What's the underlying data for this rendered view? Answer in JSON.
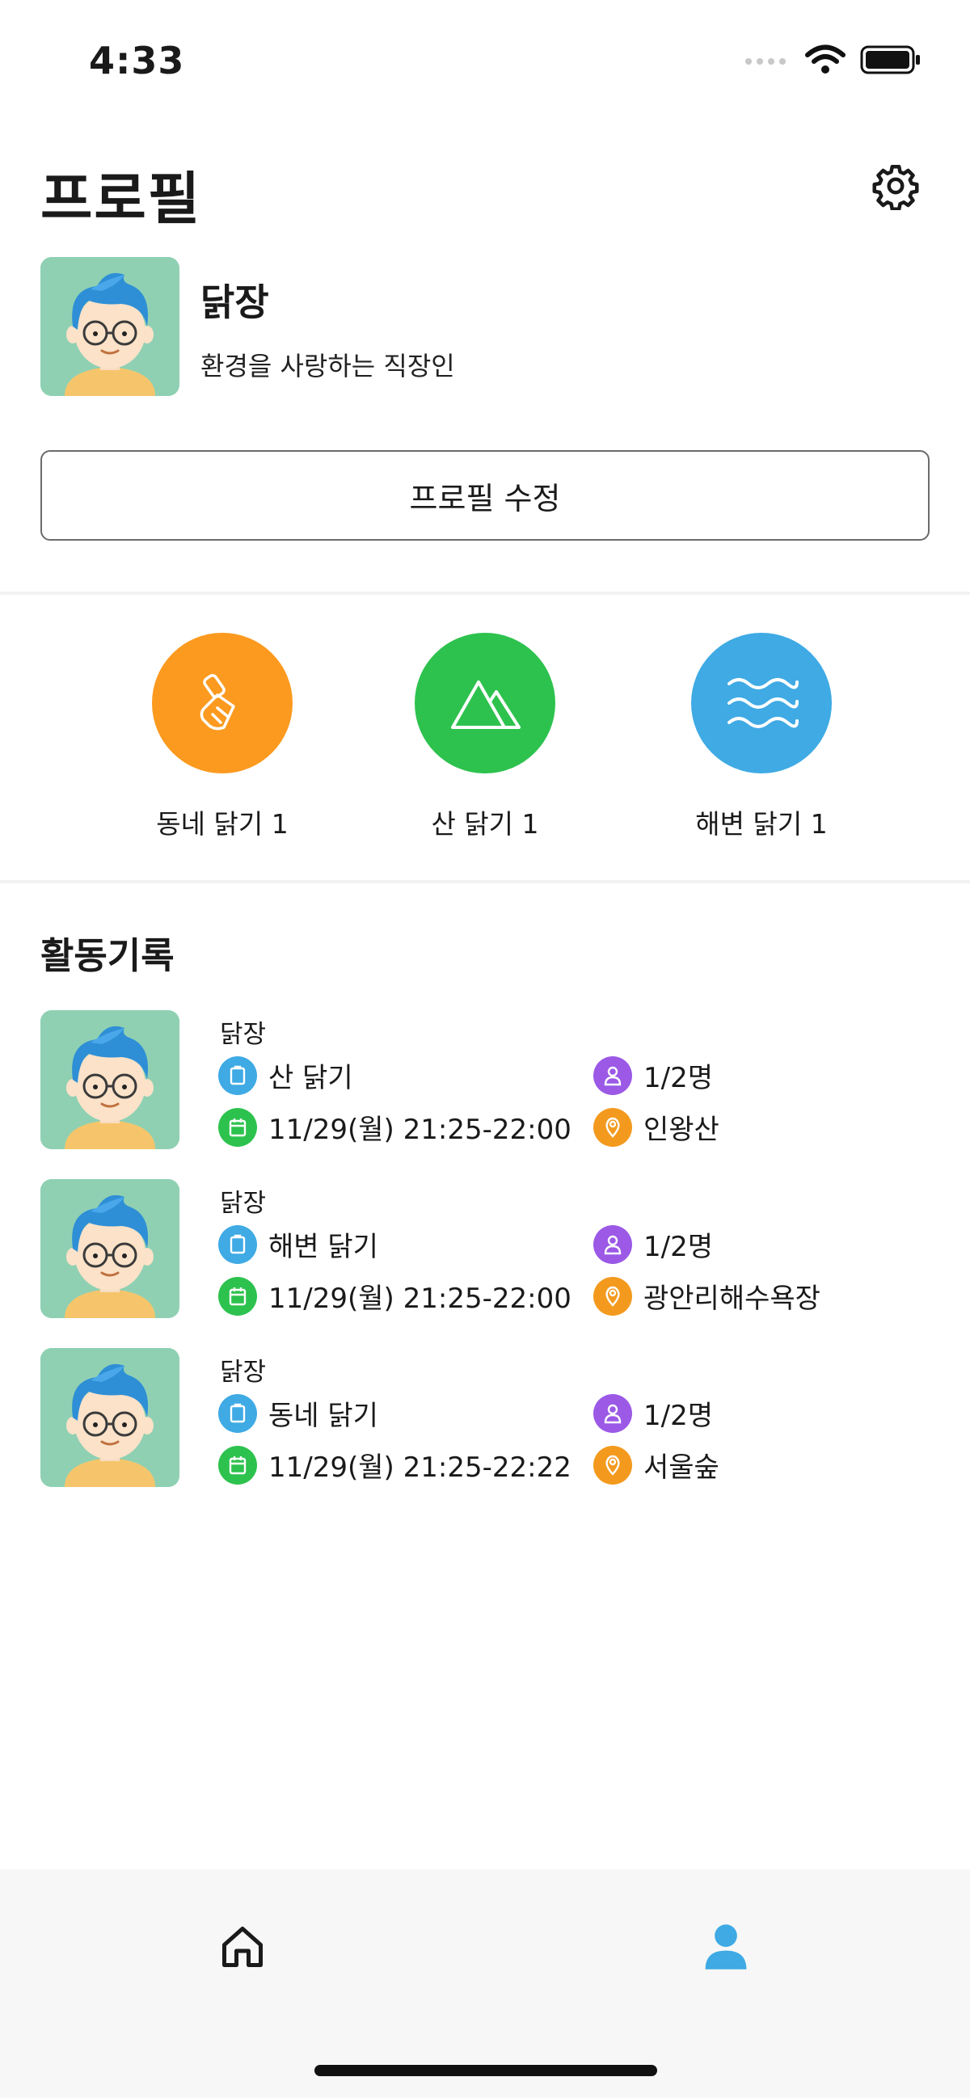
{
  "status_bar": {
    "time": "4:33"
  },
  "header": {
    "title": "프로필",
    "settings_icon": "gear-icon"
  },
  "profile": {
    "name": "닭장",
    "bio": "환경을 사랑하는 직장인",
    "edit_label": "프로필 수정"
  },
  "categories": [
    {
      "label": "동네 닭기 1",
      "icon": "broom-icon",
      "color": "#FB9A1F"
    },
    {
      "label": "산 닭기 1",
      "icon": "mountain-icon",
      "color": "#2DC24E"
    },
    {
      "label": "해변 닭기 1",
      "icon": "waves-icon",
      "color": "#3FAAE4"
    }
  ],
  "activity": {
    "title": "활동기록",
    "items": [
      {
        "user": "닭장",
        "type": "산 닭기",
        "participants": "1/2명",
        "datetime": "11/29(월) 21:25-22:00",
        "place": "인왕산"
      },
      {
        "user": "닭장",
        "type": "해변 닭기",
        "participants": "1/2명",
        "datetime": "11/29(월) 21:25-22:00",
        "place": "광안리해수욕장"
      },
      {
        "user": "닭장",
        "type": "동네 닭기",
        "participants": "1/2명",
        "datetime": "11/29(월) 21:25-22:22",
        "place": "서울숲"
      }
    ]
  },
  "icon_colors": {
    "type": "#3FAAE4",
    "participants": "#9B59E6",
    "date": "#2DC24E",
    "place": "#F39A1E"
  },
  "tab_bar": {
    "home_icon": "home-icon",
    "profile_icon": "user-icon",
    "active_color": "#3FAAE4"
  }
}
